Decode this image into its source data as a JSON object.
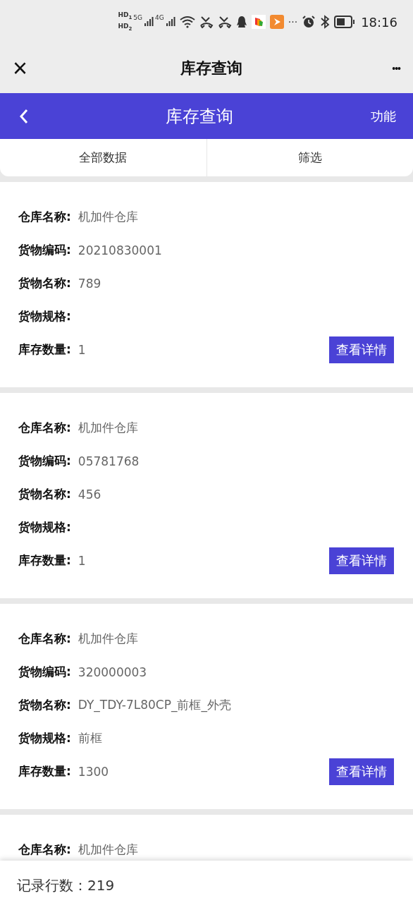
{
  "status_bar": {
    "sims": [
      {
        "hd": "HD",
        "slot": "1",
        "net": "5G"
      },
      {
        "hd": "HD",
        "slot": "2",
        "net": "4G"
      }
    ],
    "more": "···",
    "time": "18:16"
  },
  "app_bar": {
    "close": "×",
    "title": "库存查询",
    "menu": "•••"
  },
  "header": {
    "title": "库存查询",
    "action": "功能"
  },
  "tabs": [
    {
      "label": "全部数据"
    },
    {
      "label": "筛选"
    }
  ],
  "records": [
    {
      "fields": [
        {
          "label": "仓库名称:",
          "value": "机加件仓库"
        },
        {
          "label": "货物编码:",
          "value": "20210830001"
        },
        {
          "label": "货物名称:",
          "value": "789"
        },
        {
          "label": "货物规格:"
        },
        {
          "label": "库存数量:",
          "value": "1"
        }
      ],
      "button": "查看详情"
    },
    {
      "fields": [
        {
          "label": "仓库名称:",
          "value": "机加件仓库"
        },
        {
          "label": "货物编码:",
          "value": "05781768"
        },
        {
          "label": "货物名称:",
          "value": "456"
        },
        {
          "label": "货物规格:"
        },
        {
          "label": "库存数量:",
          "value": "1"
        }
      ],
      "button": "查看详情"
    },
    {
      "fields": [
        {
          "label": "仓库名称:",
          "value": "机加件仓库"
        },
        {
          "label": "货物编码:",
          "value": "320000003"
        },
        {
          "label": "货物名称:",
          "value": "DY_TDY-7L80CP_前框_外壳"
        },
        {
          "label": "货物规格:",
          "value": "前框"
        },
        {
          "label": "库存数量:",
          "value": "1300"
        }
      ],
      "button": "查看详情"
    },
    {
      "fields": [
        {
          "label": "仓库名称:",
          "value": "机加件仓库"
        }
      ]
    }
  ],
  "footer": {
    "count": "记录行数：219"
  }
}
